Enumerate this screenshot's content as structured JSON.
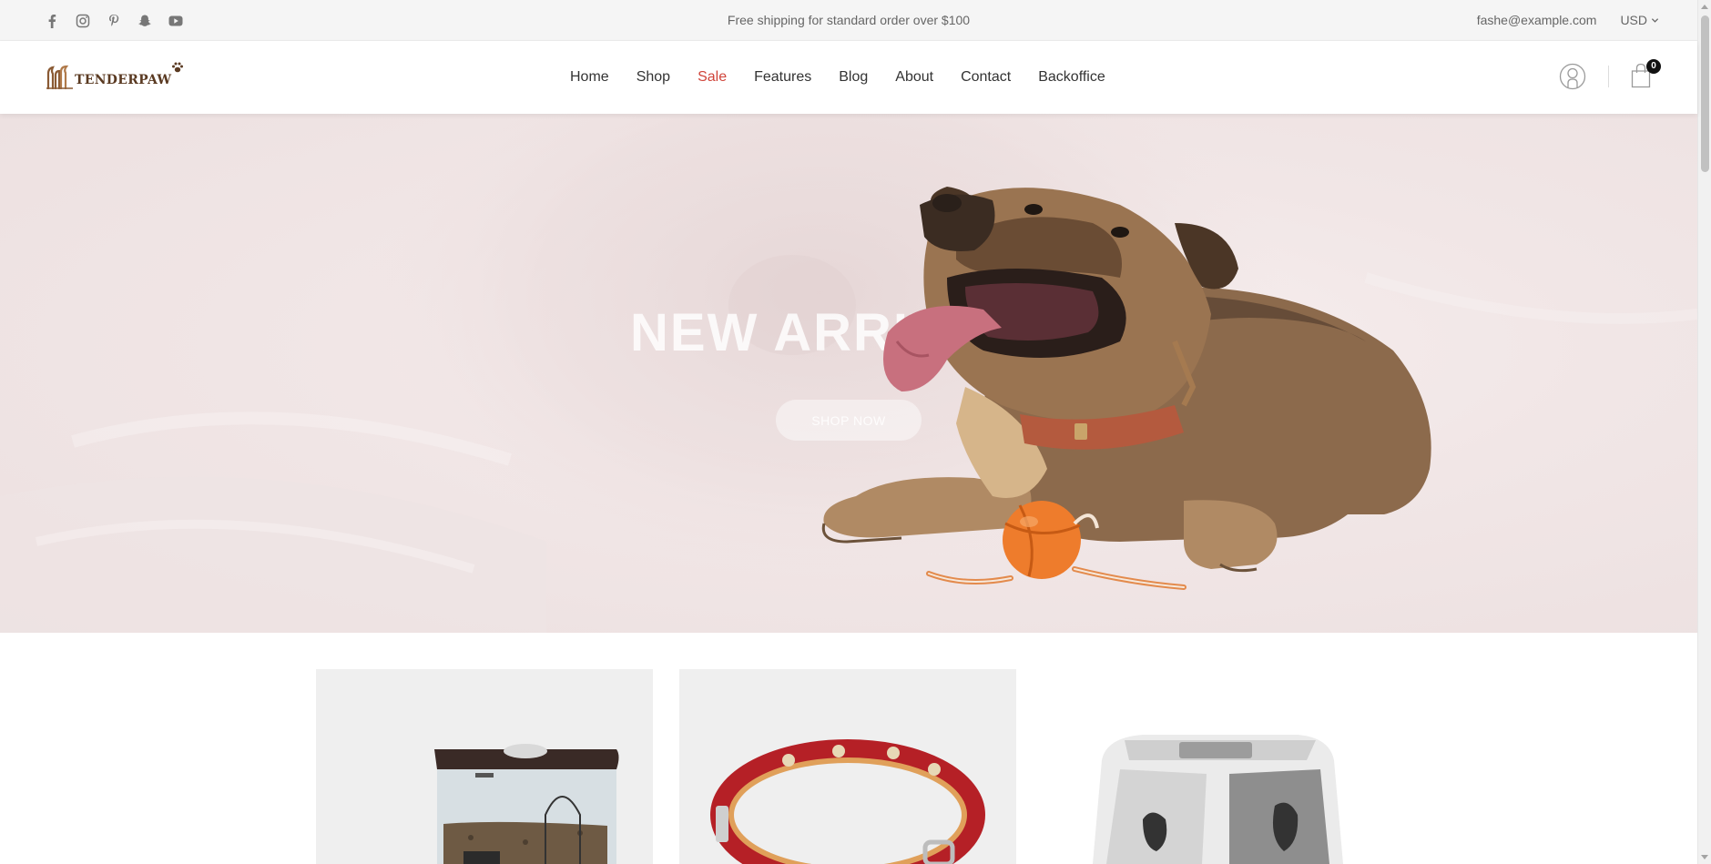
{
  "topbar": {
    "socials": [
      "facebook-icon",
      "instagram-icon",
      "pinterest-icon",
      "snapchat-icon",
      "youtube-icon"
    ],
    "promo": "Free shipping for standard order over $100",
    "email": "fashe@example.com",
    "currency": "USD"
  },
  "header": {
    "logo_text": "TENDERPAW",
    "nav": [
      {
        "label": "Home",
        "active": false
      },
      {
        "label": "Shop",
        "active": false
      },
      {
        "label": "Sale",
        "active": true
      },
      {
        "label": "Features",
        "active": false
      },
      {
        "label": "Blog",
        "active": false
      },
      {
        "label": "About",
        "active": false
      },
      {
        "label": "Contact",
        "active": false
      },
      {
        "label": "Backoffice",
        "active": false
      }
    ],
    "cart_count": "0"
  },
  "hero": {
    "title": "NEW ARRIVALS",
    "button": "SHOP NOW"
  },
  "products": [
    {
      "name": "food-dispenser-image"
    },
    {
      "name": "red-collar-image"
    },
    {
      "name": "cat-litter-box-image"
    }
  ],
  "colors": {
    "accent": "#d0443a",
    "topbar_bg": "#f5f5f5",
    "card_bg": "#efefef"
  }
}
